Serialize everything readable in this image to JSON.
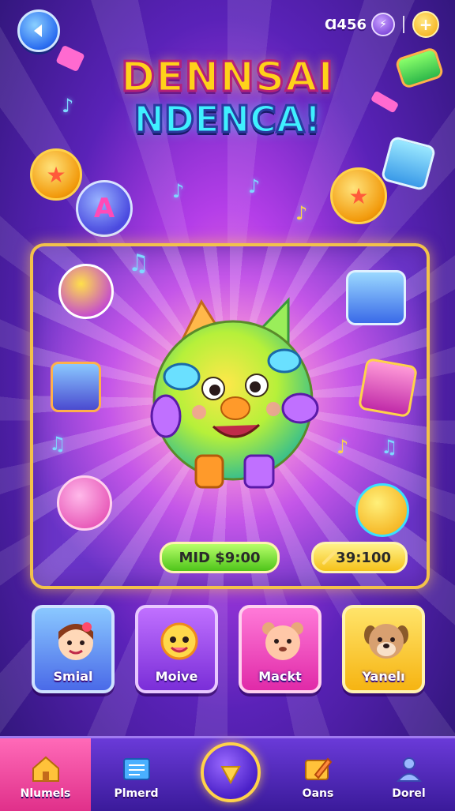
{
  "header": {
    "currency_value": "Ɑ456",
    "gem_symbol": "⚡",
    "coin_add_symbol": "+"
  },
  "title": {
    "line1": "DENNSAI",
    "line2": "NDENCA!"
  },
  "stage": {
    "price_green": "MID $9:00",
    "price_yellow": "39:100"
  },
  "cards": [
    {
      "label": "Smial"
    },
    {
      "label": "Moive"
    },
    {
      "label": "Mackt"
    },
    {
      "label": "Yanelı"
    }
  ],
  "nav": {
    "items": [
      {
        "label": "Nlumels",
        "icon": "house-icon"
      },
      {
        "label": "Plmerd",
        "icon": "board-icon"
      },
      {
        "label": "",
        "icon": "star-icon"
      },
      {
        "label": "Oans",
        "icon": "pencil-icon"
      },
      {
        "label": "Dorel",
        "icon": "user-icon"
      }
    ]
  },
  "colors": {
    "accent_gold": "#f2c24a",
    "nav_active": "#e0308a",
    "bg_purple": "#5a22b8"
  }
}
